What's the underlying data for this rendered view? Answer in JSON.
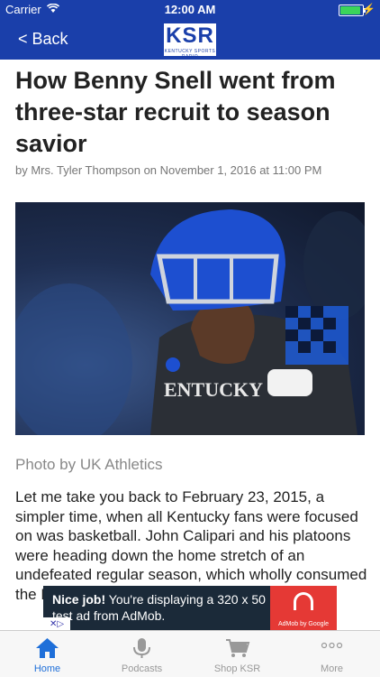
{
  "status_bar": {
    "carrier": "Carrier",
    "time": "12:00 AM"
  },
  "nav": {
    "back_label": "< Back",
    "logo_text": "KSR",
    "logo_subtext": "KENTUCKY SPORTS RADIO"
  },
  "article": {
    "title": "How Benny Snell went from three-star recruit to season savior",
    "byline": "by Mrs. Tyler Thompson on November 1, 2016 at 11:00 PM",
    "photo_caption": "Photo by UK Athletics",
    "body_text": "Let me take you back to February 23, 2015, a simpler time, when all Kentucky fans were focused on was basketball. John Calipari and his platoons were heading down the home stretch of an undefeated regular season, which wholly consumed the Big Blue Nation. Somehow, nobody"
  },
  "ad": {
    "headline": "Nice job!",
    "text": "You're displaying a 320 x 50 test ad from AdMob.",
    "sponsor": "AdMob by Google"
  },
  "tabs": [
    {
      "label": "Home",
      "icon": "home-icon",
      "active": true
    },
    {
      "label": "Podcasts",
      "icon": "microphone-icon",
      "active": false
    },
    {
      "label": "Shop KSR",
      "icon": "cart-icon",
      "active": false
    },
    {
      "label": "More",
      "icon": "more-icon",
      "active": false
    }
  ],
  "colors": {
    "nav": "#1a3faa",
    "active_tab": "#1e6fd9"
  }
}
